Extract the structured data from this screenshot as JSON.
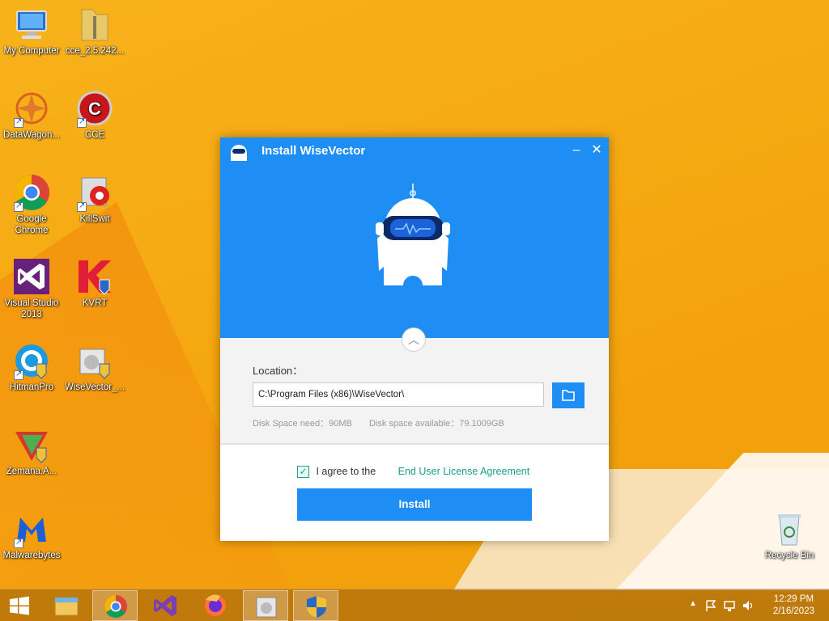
{
  "desktop": {
    "icons": [
      {
        "label": "My Computer",
        "name": "my-computer"
      },
      {
        "label": "cce_2.5.242...",
        "name": "cce-folder"
      },
      {
        "label": "DataWagon...",
        "name": "datawagon"
      },
      {
        "label": "CCE",
        "name": "cce"
      },
      {
        "label": "Google Chrome",
        "name": "google-chrome"
      },
      {
        "label": "KillSwit",
        "name": "killswitch"
      },
      {
        "label": "Visual Studio 2013",
        "name": "visual-studio-2013"
      },
      {
        "label": "KVRT",
        "name": "kvrt"
      },
      {
        "label": "HitmanPro",
        "name": "hitmanpro"
      },
      {
        "label": "WiseVector_...",
        "name": "wisevector-setup"
      },
      {
        "label": "Zemana.A...",
        "name": "zemana"
      },
      {
        "label": "Malwarebytes",
        "name": "malwarebytes"
      },
      {
        "label": "Recycle Bin",
        "name": "recycle-bin"
      }
    ]
  },
  "installer": {
    "title": "Install WiseVector",
    "location_label": "Location：",
    "location_value": "C:\\Program Files (x86)\\WiseVector\\",
    "disk_need": "Disk Space need：90MB",
    "disk_available": "Disk space available：79.1009GB",
    "agree_text": "I agree to the",
    "eula_link": "End User License Agreement",
    "agreed": true,
    "install_label": "Install",
    "minimize_glyph": "–",
    "close_glyph": "✕",
    "collapse_glyph": "︿",
    "accent": "#1e8ef4",
    "link_color": "#19a084"
  },
  "taskbar": {
    "start_icon": "windows-logo-icon",
    "apps": [
      "file-explorer",
      "google-chrome",
      "visual-studio",
      "firefox",
      "wisevector-setup",
      "uac-shield"
    ],
    "clock_time": "12:29 PM",
    "clock_date": "2/16/2023"
  }
}
